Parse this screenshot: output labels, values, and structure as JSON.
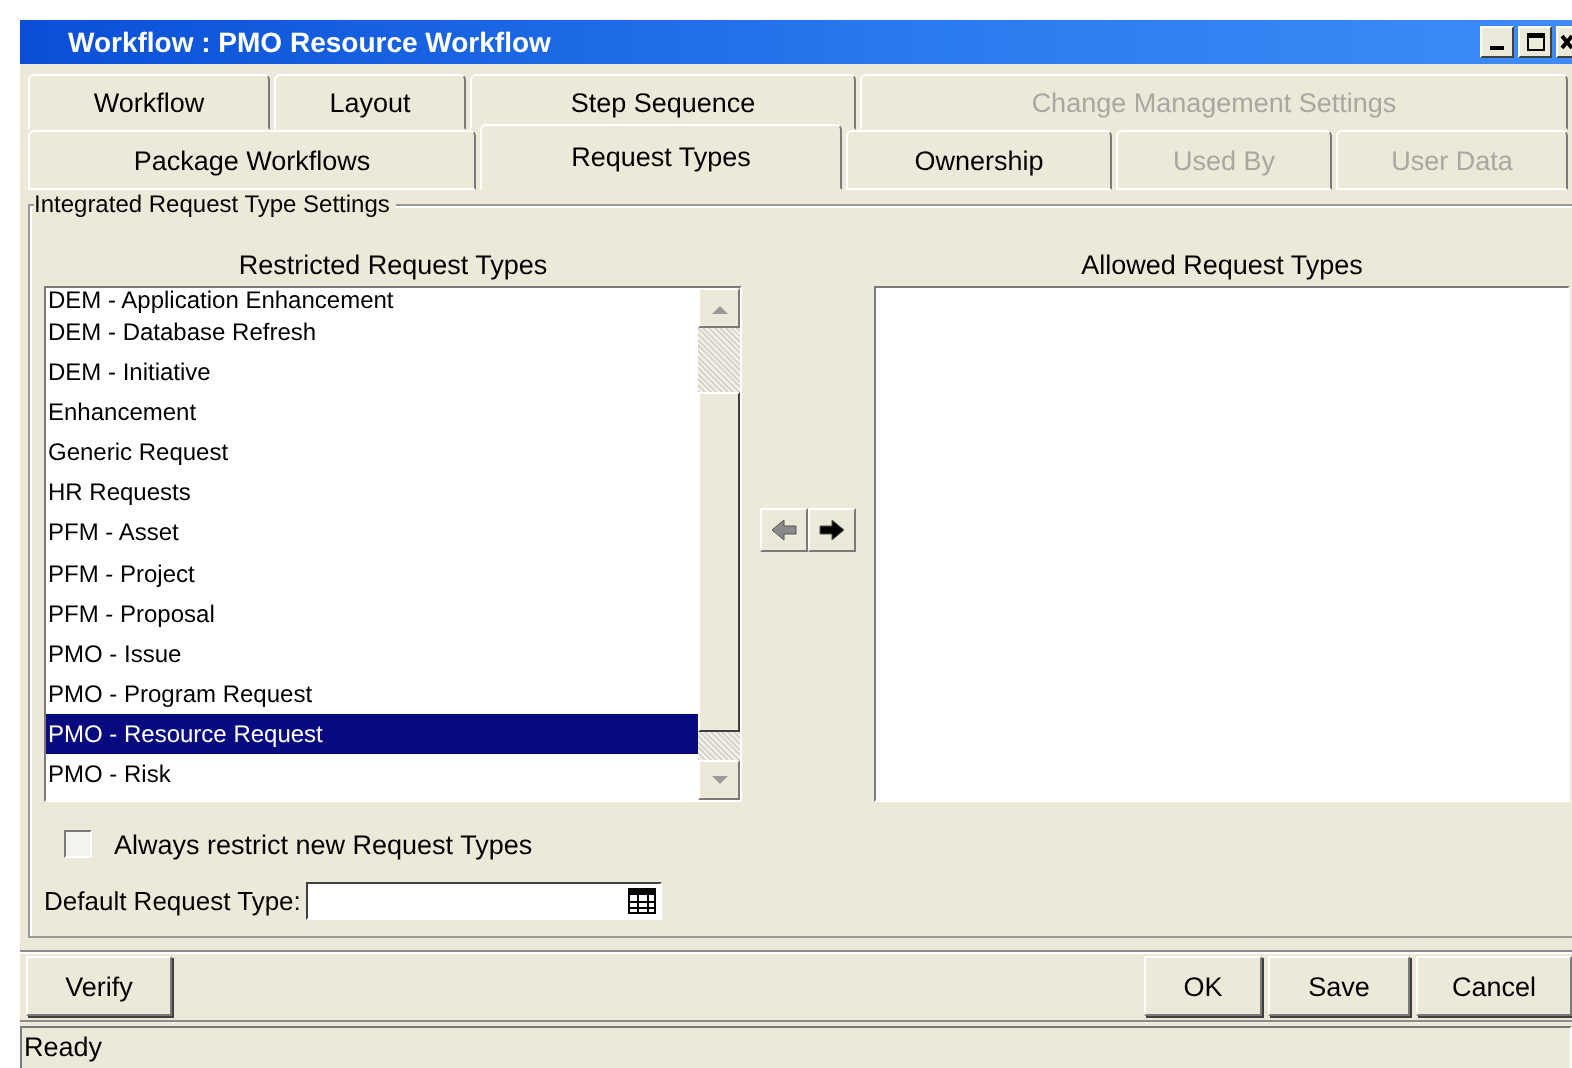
{
  "window": {
    "title": "Workflow : PMO Resource Workflow"
  },
  "tab_rows": [
    [
      {
        "label": "Workflow",
        "selected": false,
        "disabled": false
      },
      {
        "label": "Layout",
        "selected": false,
        "disabled": false
      },
      {
        "label": "Step Sequence",
        "selected": false,
        "disabled": false
      },
      {
        "label": "Change Management Settings",
        "selected": false,
        "disabled": true
      }
    ],
    [
      {
        "label": "Package Workflows",
        "selected": false,
        "disabled": false
      },
      {
        "label": "Request Types",
        "selected": true,
        "disabled": false
      },
      {
        "label": "Ownership",
        "selected": false,
        "disabled": false
      },
      {
        "label": "Used By",
        "selected": false,
        "disabled": true
      },
      {
        "label": "User Data",
        "selected": false,
        "disabled": true
      }
    ]
  ],
  "group": {
    "title": "Integrated Request Type Settings"
  },
  "restricted": {
    "title": "Restricted Request Types",
    "items": [
      {
        "label": "DEM - Application Enhancement",
        "selected": false
      },
      {
        "label": "DEM - Database Refresh",
        "selected": false
      },
      {
        "label": "DEM - Initiative",
        "selected": false
      },
      {
        "label": "Enhancement",
        "selected": false
      },
      {
        "label": "Generic Request",
        "selected": false
      },
      {
        "label": "HR Requests",
        "selected": false
      },
      {
        "label": "PFM - Asset",
        "selected": false
      },
      {
        "label": "PFM - Project",
        "selected": false
      },
      {
        "label": "PFM - Proposal",
        "selected": false
      },
      {
        "label": "PMO - Issue",
        "selected": false
      },
      {
        "label": "PMO - Program Request",
        "selected": false
      },
      {
        "label": "PMO - Resource Request",
        "selected": true
      },
      {
        "label": "PMO - Risk",
        "selected": false
      }
    ]
  },
  "move_buttons": [
    {
      "kind": "left",
      "disabled": true
    },
    {
      "kind": "right",
      "disabled": false
    }
  ],
  "allowed": {
    "title": "Allowed Request Types"
  },
  "always_restrict": {
    "label": "Always restrict new Request Types",
    "checked": false
  },
  "default_type": {
    "label": "Default Request Type:"
  },
  "buttons_left": [
    "Verify"
  ],
  "buttons_right": [
    "OK",
    "Save",
    "Cancel"
  ],
  "status_bar": "Ready"
}
